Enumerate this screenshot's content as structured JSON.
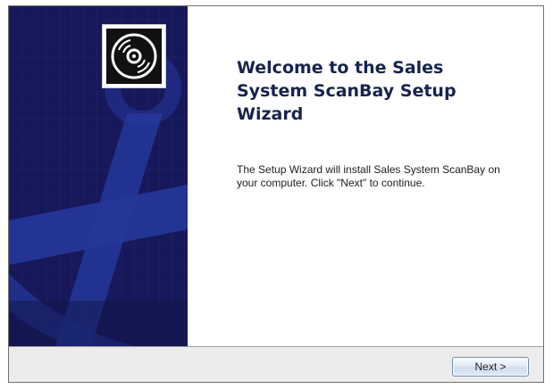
{
  "wizard": {
    "title": "Welcome to the Sales System ScanBay Setup Wizard",
    "description": "The Setup Wizard will install Sales System ScanBay on your computer. Click \"Next\" to continue.",
    "next_label": "Next >"
  },
  "icons": {
    "logo": "cd-disc-icon",
    "banner_art": "anchor-icon"
  },
  "colors": {
    "banner_background": "#17185b",
    "banner_art": "#25379a",
    "title_text": "#16244f",
    "footer_background": "#ececec"
  }
}
